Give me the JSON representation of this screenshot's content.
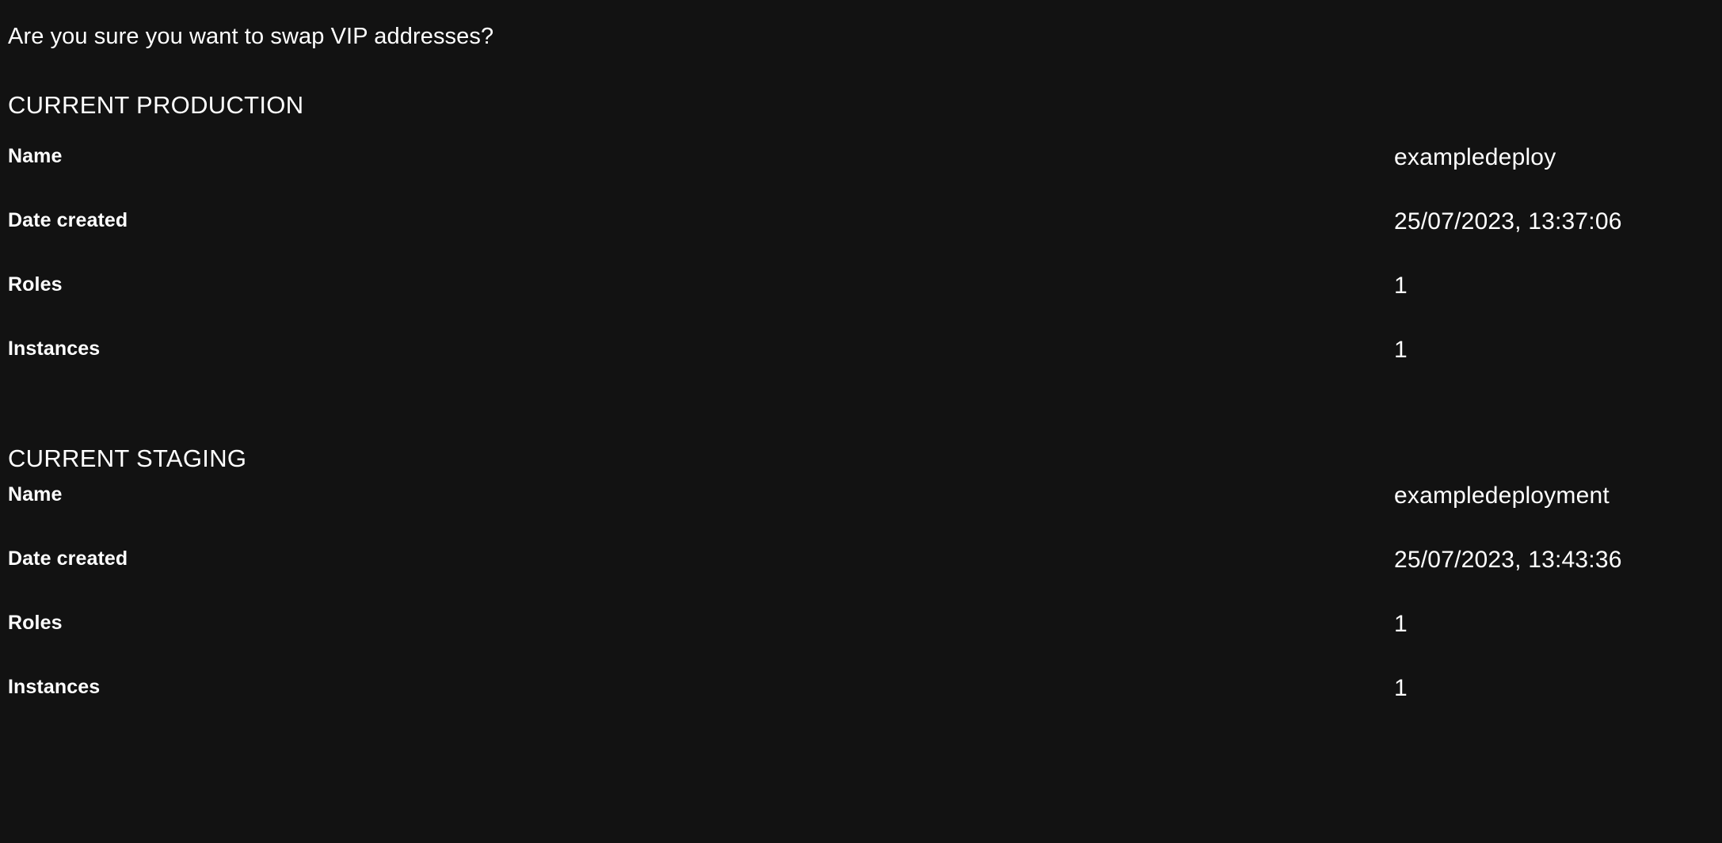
{
  "dialog": {
    "question": "Are you sure you want to swap VIP addresses?",
    "background_color": "#121212",
    "text_color": "#ffffff"
  },
  "sections": [
    {
      "title": "CURRENT PRODUCTION",
      "rows": [
        {
          "label": "Name",
          "value": "exampledeploy"
        },
        {
          "label": "Date created",
          "value": "25/07/2023, 13:37:06"
        },
        {
          "label": "Roles",
          "value": "1"
        },
        {
          "label": "Instances",
          "value": "1"
        }
      ]
    },
    {
      "title": "CURRENT STAGING",
      "rows": [
        {
          "label": "Name",
          "value": "exampledeployment"
        },
        {
          "label": "Date created",
          "value": "25/07/2023, 13:43:36"
        },
        {
          "label": "Roles",
          "value": "1"
        },
        {
          "label": "Instances",
          "value": "1"
        }
      ]
    }
  ]
}
